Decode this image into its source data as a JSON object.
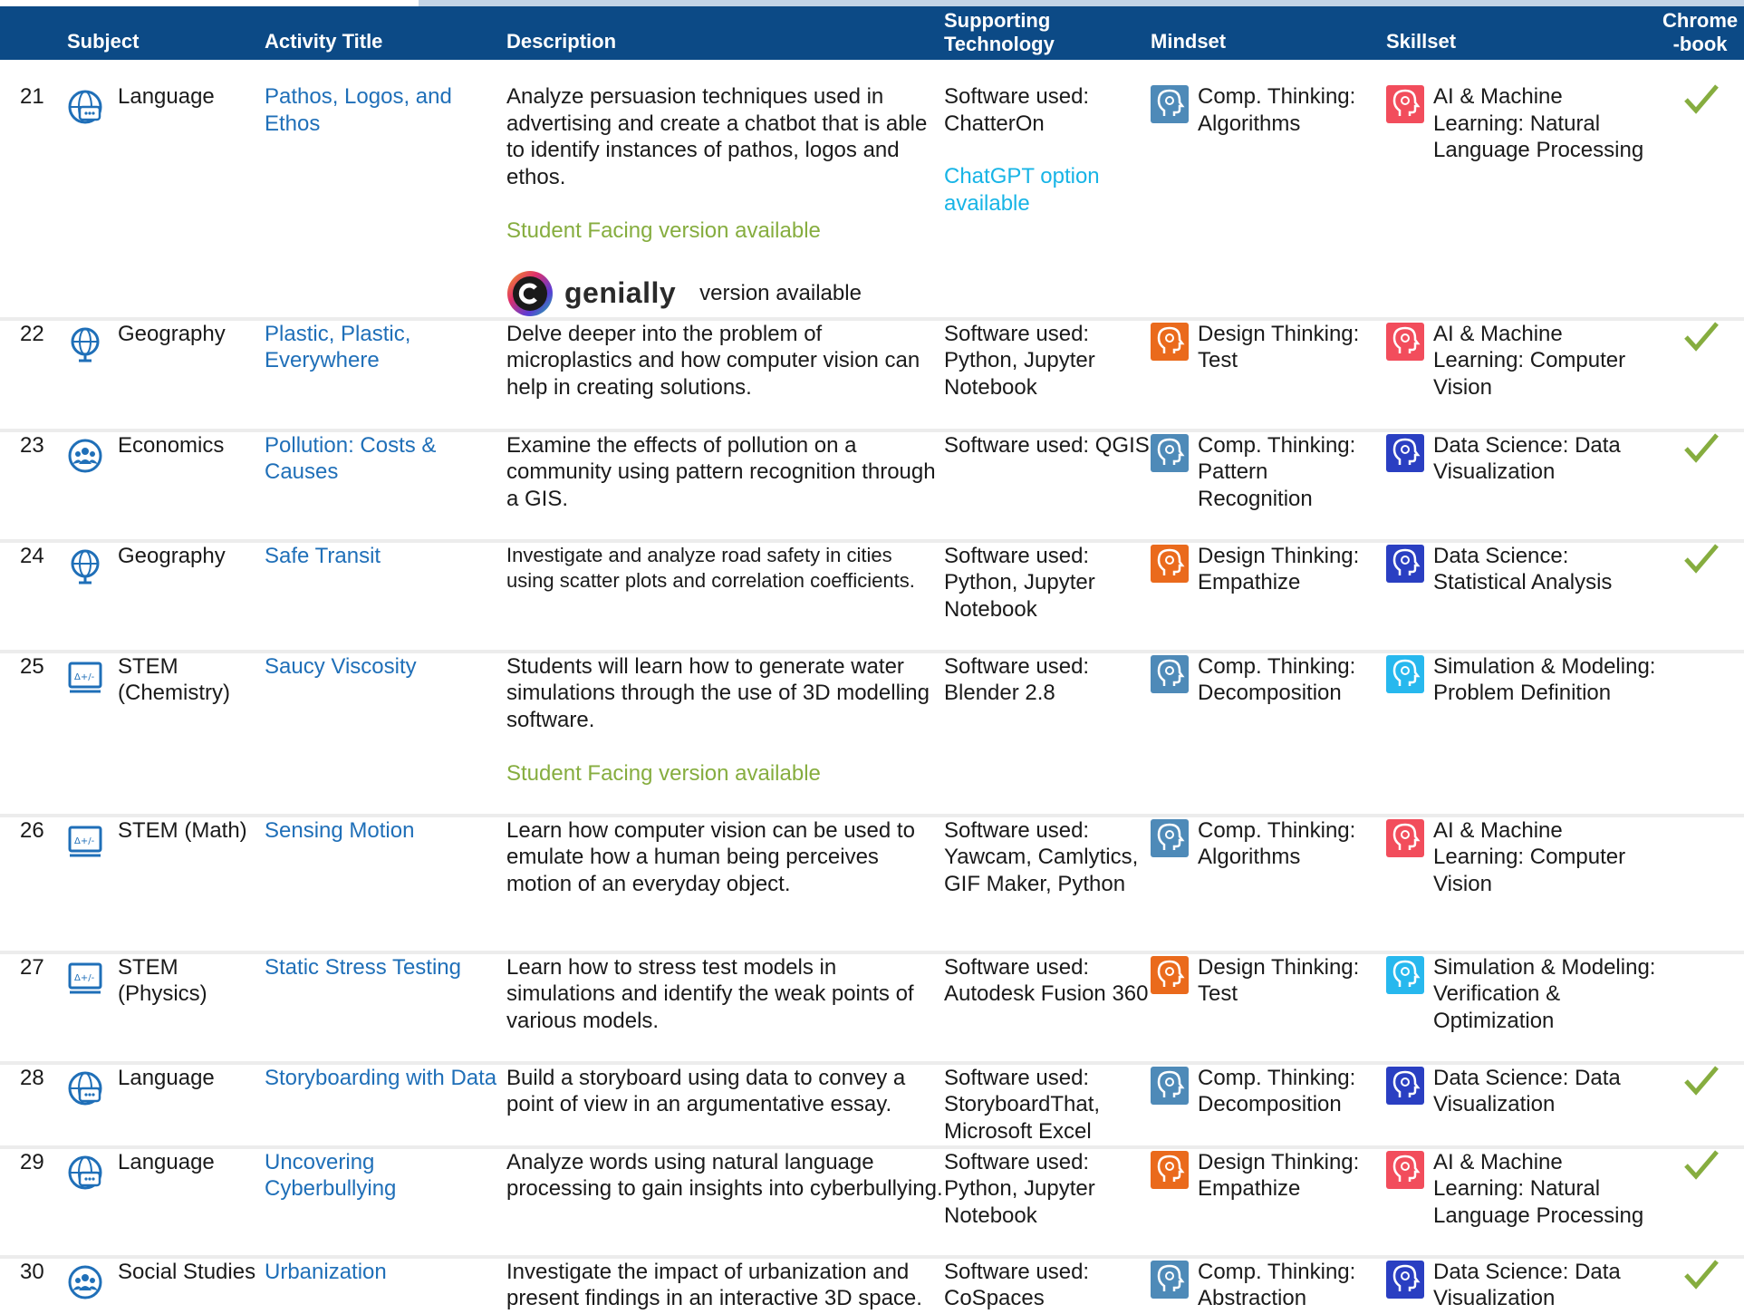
{
  "header": {
    "subject": "Subject",
    "activity_title": "Activity Title",
    "description": "Description",
    "supporting_line1": "Supporting",
    "supporting_line2": "Technology",
    "mindset": "Mindset",
    "skillset": "Skillset",
    "chromebook_line1": "Chrome",
    "chromebook_line2": "-book"
  },
  "colors": {
    "header_bg": "#0c4a86",
    "title_link": "#1f6fb8",
    "student_facing": "#86ad3f",
    "chatgpt": "#17b4e6",
    "check": "#86ad3f",
    "comp_thinking": "#4e8ab8",
    "design_thinking": "#ea6a1c",
    "ai_ml": "#f24d5c",
    "data_science": "#2a3fc2",
    "simulation": "#27b8ee"
  },
  "rows": [
    {
      "num": "21",
      "subject_icon": "language-icon",
      "subject": "Language",
      "title": "Pathos, Logos, and Ethos",
      "description": "Analyze persuasion techniques used in advertising and create a chatbot that is able to identify instances of pathos, logos and ethos.",
      "student_facing": "Student Facing version available",
      "genially_brand": "genially",
      "genially_text": "version available",
      "technology": "Software used: ChatterOn",
      "technology_extra": "ChatGPT option available",
      "mindset_icon": "comp-thinking-icon",
      "mindset": "Comp. Thinking: Algorithms",
      "skillset_icon": "ai-ml-icon",
      "skillset": "AI & Machine Learning: Natural Language Processing",
      "chromebook": "✓"
    },
    {
      "num": "22",
      "subject_icon": "geography-globe-icon",
      "subject": "Geography",
      "title": "Plastic, Plastic, Everywhere",
      "description": "Delve deeper into the problem of microplastics and how computer vision can help in creating solutions.",
      "technology": "Software used: Python, Jupyter Notebook",
      "mindset_icon": "design-thinking-icon",
      "mindset": "Design Thinking: Test",
      "skillset_icon": "ai-ml-icon",
      "skillset": "AI & Machine Learning: Computer Vision",
      "chromebook": "✓"
    },
    {
      "num": "23",
      "subject_icon": "economics-people-icon",
      "subject": "Economics",
      "title": "Pollution: Costs & Causes",
      "description": "Examine the effects of pollution on a community using pattern recognition through a GIS.",
      "technology": "Software used: QGIS",
      "mindset_icon": "comp-thinking-icon",
      "mindset": "Comp. Thinking: Pattern Recognition",
      "skillset_icon": "data-science-icon",
      "skillset": "Data Science:  Data Visualization",
      "chromebook": "✓"
    },
    {
      "num": "24",
      "subject_icon": "geography-globe-icon",
      "subject": "Geography",
      "title": "Safe Transit",
      "description": "Investigate and analyze road safety in cities using scatter plots and correlation coefficients.",
      "technology": "Software used: Python, Jupyter Notebook",
      "mindset_icon": "design-thinking-icon",
      "mindset": "Design Thinking: Empathize",
      "skillset_icon": "data-science-icon",
      "skillset": "Data Science: Statistical Analysis",
      "chromebook": "✓"
    },
    {
      "num": "25",
      "subject_icon": "stem-monitor-icon",
      "subject": "STEM (Chemistry)",
      "title": "Saucy Viscosity",
      "description": "Students will learn how to generate water simulations through the use of 3D modelling software.",
      "student_facing": "Student Facing version available",
      "technology": "Software used: Blender 2.8",
      "mindset_icon": "comp-thinking-icon",
      "mindset": "Comp. Thinking: Decomposition",
      "skillset_icon": "simulation-icon",
      "skillset": "Simulation & Modeling: Problem Definition",
      "chromebook": ""
    },
    {
      "num": "26",
      "subject_icon": "stem-monitor-icon",
      "subject": "STEM (Math)",
      "title": "Sensing Motion",
      "description": "Learn how computer vision can be used to emulate how a human being perceives motion of an everyday object.",
      "technology": "Software used: Yawcam, Camlytics, GIF Maker, Python",
      "mindset_icon": "comp-thinking-icon",
      "mindset": "Comp. Thinking: Algorithms",
      "skillset_icon": "ai-ml-icon",
      "skillset": "AI & Machine Learning: Computer Vision",
      "chromebook": ""
    },
    {
      "num": "27",
      "subject_icon": "stem-monitor-icon",
      "subject": "STEM (Physics)",
      "title": "Static Stress Testing",
      "description": "Learn how to stress test models in simulations and identify the weak points of various models.",
      "technology": "Software used: Autodesk Fusion 360",
      "mindset_icon": "design-thinking-icon",
      "mindset": "Design Thinking: Test",
      "skillset_icon": "simulation-icon",
      "skillset": "Simulation & Modeling: Verification & Optimization",
      "chromebook": ""
    },
    {
      "num": "28",
      "subject_icon": "language-icon",
      "subject": "Language",
      "title": "Storyboarding with Data",
      "description": "Build a storyboard using data to convey a point of view in an argumentative essay.",
      "technology": "Software used: StoryboardThat, Microsoft Excel",
      "mindset_icon": "comp-thinking-icon",
      "mindset": "Comp. Thinking: Decomposition",
      "skillset_icon": "data-science-icon",
      "skillset": "Data Science:  Data Visualization",
      "chromebook": "✓"
    },
    {
      "num": "29",
      "subject_icon": "language-icon",
      "subject": "Language",
      "title": "Uncovering Cyberbullying",
      "description": "Analyze words using natural language processing to gain insights into cyberbullying.",
      "technology": "Software used: Python, Jupyter Notebook",
      "mindset_icon": "design-thinking-icon",
      "mindset": "Design Thinking: Empathize",
      "skillset_icon": "ai-ml-icon",
      "skillset": "AI & Machine Learning: Natural Language Processing",
      "chromebook": "✓"
    },
    {
      "num": "30",
      "subject_icon": "economics-people-icon",
      "subject": "Social Studies",
      "title": "Urbanization",
      "description": "Investigate the impact of urbanization and present findings in an interactive 3D space.",
      "technology": "Software used: CoSpaces",
      "mindset_icon": "comp-thinking-icon",
      "mindset": "Comp. Thinking: Abstraction",
      "skillset_icon": "data-science-icon",
      "skillset": "Data Science: Data Visualization",
      "chromebook": "✓"
    }
  ]
}
